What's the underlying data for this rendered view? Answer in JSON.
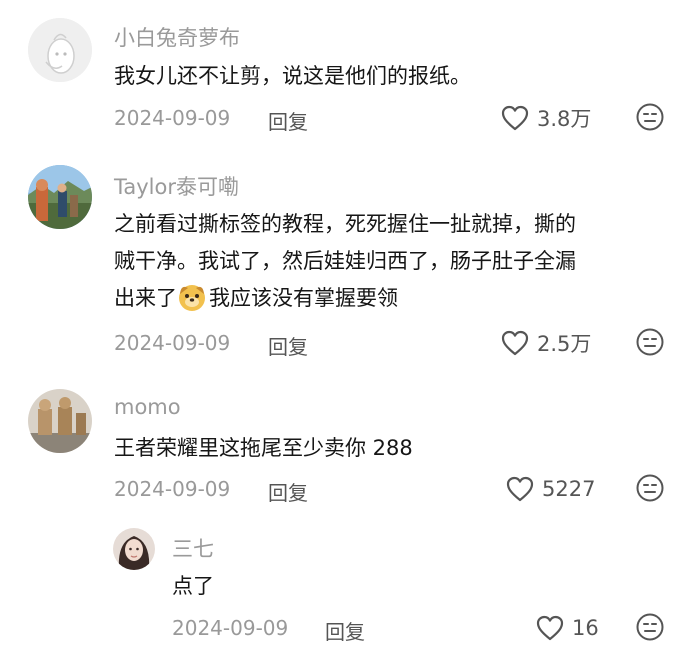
{
  "comments": [
    {
      "username": "小白兔奇萝布",
      "lines": [
        "我女儿还不让剪，说这是他们的报纸。"
      ],
      "date": "2024-09-09",
      "reply_label": "回复",
      "likes": "3.8万"
    },
    {
      "username": "Taylor泰可嘞",
      "lines": [
        "之前看过撕标签的教程，死死握住一扯就掉，撕的",
        "贼干净。我试了，然后娃娃归西了，肠子肚子全漏"
      ],
      "line3_before": "出来了",
      "line3_after": "我应该没有掌握要领",
      "date": "2024-09-09",
      "reply_label": "回复",
      "likes": "2.5万"
    },
    {
      "username": "momo",
      "lines": [
        "王者荣耀里这拖尾至少卖你 288"
      ],
      "date": "2024-09-09",
      "reply_label": "回复",
      "likes": "5227"
    }
  ],
  "reply": {
    "username": "三七",
    "text": "点了",
    "date": "2024-09-09",
    "reply_label": "回复",
    "likes": "16"
  }
}
